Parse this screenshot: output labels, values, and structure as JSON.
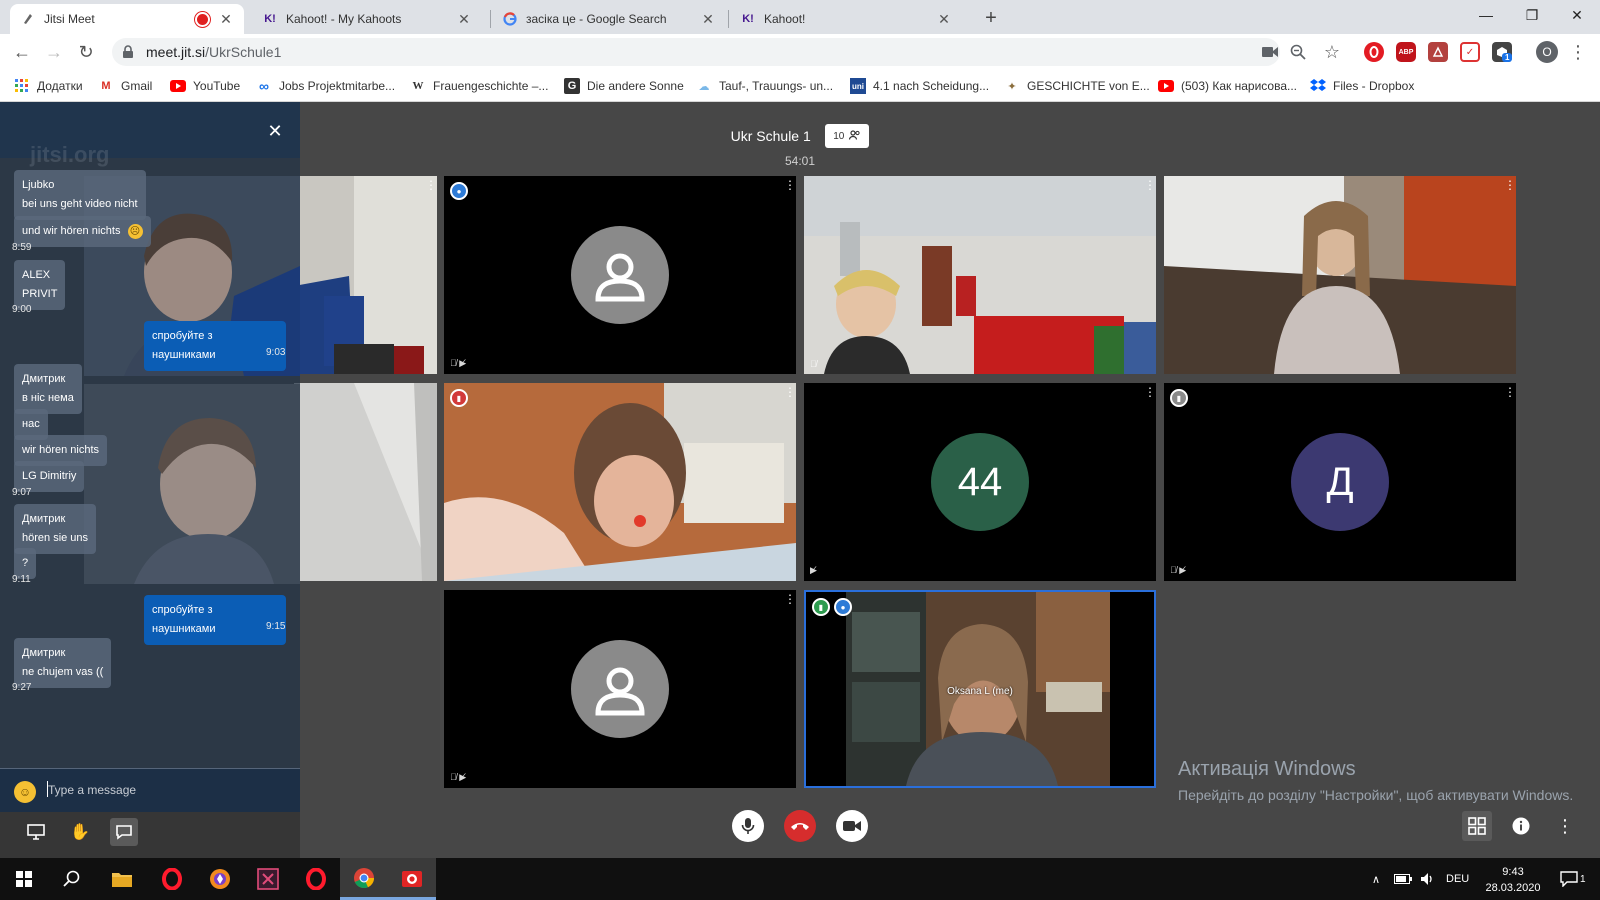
{
  "browser": {
    "tabs": [
      {
        "title": "Jitsi Meet",
        "icon": "jitsi-icon",
        "recording": true
      },
      {
        "title": "Kahoot! - My Kahoots",
        "icon": "kahoot-icon"
      },
      {
        "title": "засіка це - Google Search",
        "icon": "google-icon"
      },
      {
        "title": "Kahoot!",
        "icon": "kahoot-icon"
      }
    ],
    "url_host": "meet.jit.si",
    "url_path": "/UkrSchule1",
    "new_tab_symbol": "+",
    "profile_initial": "O",
    "ext_badge": "1",
    "abp_label": "ABP"
  },
  "bookmarks": [
    {
      "label": "Додатки",
      "icon": "apps-grid-icon"
    },
    {
      "label": "Gmail",
      "icon": "gmail-icon"
    },
    {
      "label": "YouTube",
      "icon": "youtube-icon"
    },
    {
      "label": "Jobs Projektmitarbe...",
      "icon": "infinity-icon"
    },
    {
      "label": "Frauengeschichte –...",
      "icon": "w-icon"
    },
    {
      "label": "Die andere Sonne",
      "icon": "g-square-icon"
    },
    {
      "label": "Tauf-, Trauungs- un...",
      "icon": "cloud-icon"
    },
    {
      "label": "4.1 nach Scheidung...",
      "icon": "uni-icon"
    },
    {
      "label": "GESCHICHTE von E...",
      "icon": "figure-icon"
    },
    {
      "label": "(503) Как нарисова...",
      "icon": "youtube-icon"
    },
    {
      "label": "Files - Dropbox",
      "icon": "dropbox-icon"
    }
  ],
  "meeting": {
    "subject": "Ukr Schule 1",
    "participant_count": "10",
    "timer": "54:01",
    "watermark": "jitsi.org",
    "self_name": "Oksana L (me)",
    "avatar_numbers": "44",
    "avatar_letter": "Д"
  },
  "chat": {
    "placeholder": "Type a message",
    "messages": [
      {
        "sender": "Ljubko",
        "lines": [
          "bei uns geht video nicht",
          "und wir hören nichts"
        ],
        "time": "8:59",
        "emoji": "frown-emoji"
      },
      {
        "sender": "ALEX",
        "lines": [
          "PRIVIT"
        ],
        "time": "9:00"
      },
      {
        "mine": true,
        "lines": [
          "спробуйте з наушниками"
        ],
        "time": "9:03"
      },
      {
        "sender": "Дмитрик",
        "lines": [
          "в нiс нема",
          "нас",
          "wir hören nichts",
          "LG Dimitriy"
        ],
        "time": "9:07"
      },
      {
        "sender": "Дмитрик",
        "lines": [
          "hören sie uns",
          "?"
        ],
        "time": "9:11"
      },
      {
        "mine": true,
        "lines": [
          "спробуйте з наушниками"
        ],
        "time": "9:15"
      },
      {
        "sender": "Дмитрик",
        "lines": [
          "ne chujem vas (("
        ],
        "time": "9:27"
      }
    ]
  },
  "windows_activation": {
    "title": "Активація Windows",
    "text": "Перейдіть до розділу \"Настройки\", щоб активувати Windows."
  },
  "taskbar": {
    "language": "DEU",
    "time": "9:43",
    "date": "28.03.2020",
    "notification_count": "1"
  },
  "colors": {
    "stage_bg": "#474747",
    "chat_bg": "#233347",
    "my_bubble": "#0b5db5",
    "hangup": "#d62d2d",
    "avatar_44": "#2a6048",
    "avatar_letter": "#3c3971",
    "active_border": "#2a6fdb"
  }
}
